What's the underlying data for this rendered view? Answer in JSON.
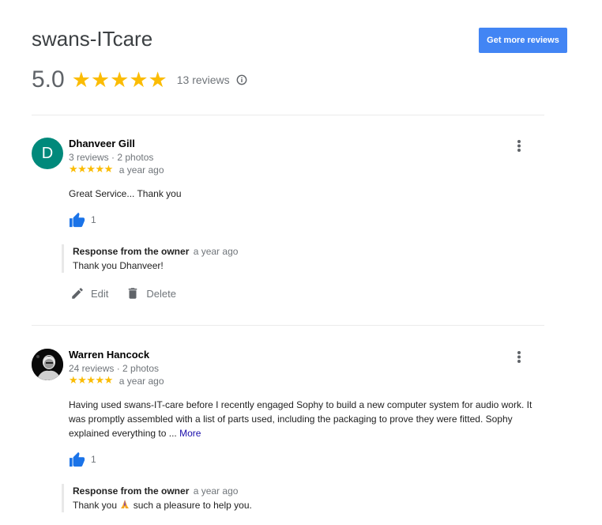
{
  "header": {
    "business_name": "swans-ITcare",
    "get_more_reviews_label": "Get more reviews",
    "score": "5.0",
    "stars": "★★★★★",
    "review_count": "13 reviews"
  },
  "reviews": [
    {
      "avatar_letter": "D",
      "avatar_color": "#00897b",
      "name": "Dhanveer Gill",
      "meta": "3 reviews · 2 photos",
      "stars": "★★★★★",
      "time": "a year ago",
      "text": "Great Service... Thank you",
      "likes": "1",
      "response": {
        "owner_label": "Response from the owner",
        "time": "a year ago",
        "text": "Thank you Dhanveer!"
      },
      "actions": {
        "edit": "Edit",
        "delete": "Delete"
      }
    },
    {
      "name": "Warren Hancock",
      "meta": "24 reviews · 2 photos",
      "stars": "★★★★★",
      "time": "a year ago",
      "text": "Having used swans-IT-care before I recently engaged Sophy to build a new computer system for audio work. It was promptly assembled with a list of parts used, including the packaging to prove they were fitted. Sophy explained everything to ...",
      "more_label": "More",
      "likes": "1",
      "response": {
        "owner_label": "Response from the owner",
        "time": "a year ago",
        "text_before": "Thank you",
        "text_after": "such a pleasure to help you."
      }
    }
  ],
  "colors": {
    "accent": "#4285f4",
    "star": "#fbbc04",
    "like": "#1a73e8"
  }
}
